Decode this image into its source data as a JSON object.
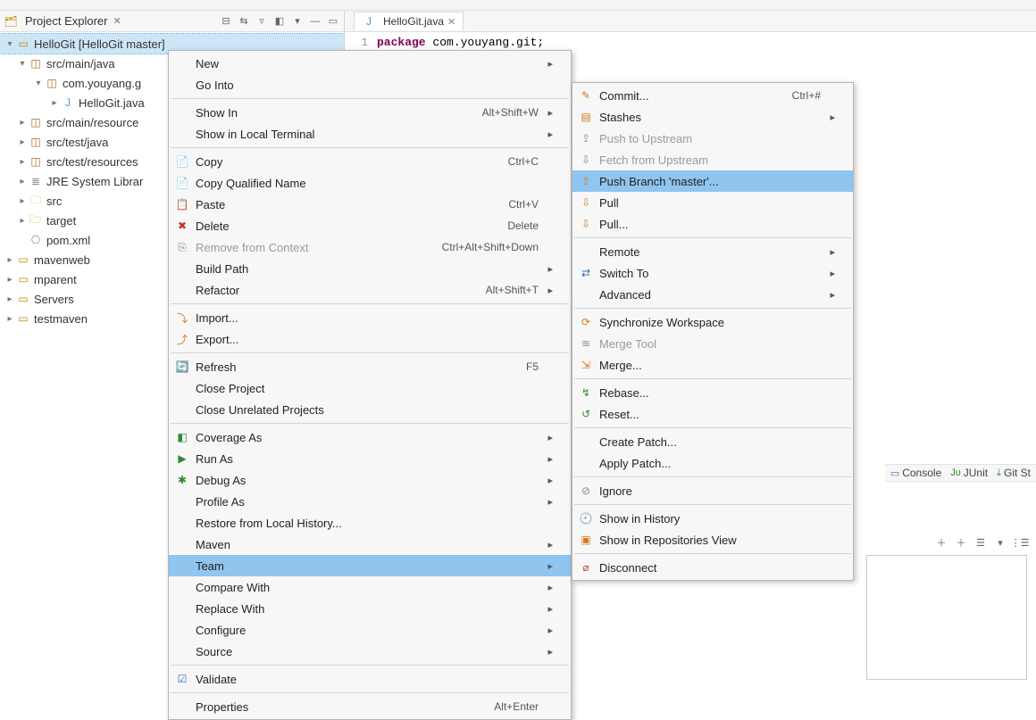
{
  "explorer": {
    "title": "Project Explorer",
    "tree": [
      {
        "id": "hellogit",
        "label": "HelloGit [HelloGit master]",
        "depth": 0,
        "icon": "project",
        "expanded": true,
        "selected": true
      },
      {
        "id": "src-main-java",
        "label": "src/main/java",
        "depth": 1,
        "icon": "pkg",
        "expanded": true
      },
      {
        "id": "com-youyang",
        "label": "com.youyang.g",
        "depth": 2,
        "icon": "pkg",
        "expanded": true
      },
      {
        "id": "hellogit-java",
        "label": "HelloGit.java",
        "depth": 3,
        "icon": "javafile",
        "expanded": false,
        "leafArrow": true
      },
      {
        "id": "src-main-res",
        "label": "src/main/resource",
        "depth": 1,
        "icon": "pkg",
        "expanded": false,
        "leafArrow": true
      },
      {
        "id": "src-test-java",
        "label": "src/test/java",
        "depth": 1,
        "icon": "pkg",
        "expanded": false,
        "leafArrow": true
      },
      {
        "id": "src-test-res",
        "label": "src/test/resources",
        "depth": 1,
        "icon": "pkg",
        "expanded": false,
        "leafArrow": true
      },
      {
        "id": "jre",
        "label": "JRE System Librar",
        "depth": 1,
        "icon": "jar",
        "expanded": false,
        "leafArrow": true
      },
      {
        "id": "src-folder",
        "label": "src",
        "depth": 1,
        "icon": "folder",
        "expanded": false,
        "leafArrow": true
      },
      {
        "id": "target",
        "label": "target",
        "depth": 1,
        "icon": "folder-open",
        "expanded": false,
        "leafArrow": true
      },
      {
        "id": "pom",
        "label": "pom.xml",
        "depth": 1,
        "icon": "xml",
        "expanded": false
      },
      {
        "id": "mavenweb",
        "label": "mavenweb",
        "depth": 0,
        "icon": "project",
        "expanded": false,
        "leafArrow": true
      },
      {
        "id": "mparent",
        "label": "mparent",
        "depth": 0,
        "icon": "project",
        "expanded": false,
        "leafArrow": true
      },
      {
        "id": "servers",
        "label": "Servers",
        "depth": 0,
        "icon": "project",
        "expanded": false,
        "leafArrow": true
      },
      {
        "id": "testmaven",
        "label": "testmaven",
        "depth": 0,
        "icon": "project",
        "expanded": false,
        "leafArrow": true
      }
    ]
  },
  "editor": {
    "tab": "HelloGit.java",
    "lineno": "1",
    "kw": "package",
    "rest": " com.youyang.git;"
  },
  "contextMenu": [
    {
      "label": "New",
      "submenu": true
    },
    {
      "label": "Go Into"
    },
    {
      "sep": true
    },
    {
      "label": "Show In",
      "accel": "Alt+Shift+W",
      "submenu": true
    },
    {
      "label": "Show in Local Terminal",
      "submenu": true
    },
    {
      "sep": true
    },
    {
      "label": "Copy",
      "icon": "copy",
      "accel": "Ctrl+C"
    },
    {
      "label": "Copy Qualified Name",
      "icon": "copy"
    },
    {
      "label": "Paste",
      "icon": "paste",
      "accel": "Ctrl+V"
    },
    {
      "label": "Delete",
      "icon": "delete",
      "accel": "Delete"
    },
    {
      "label": "Remove from Context",
      "icon": "remove",
      "accel": "Ctrl+Alt+Shift+Down",
      "disabled": true
    },
    {
      "label": "Build Path",
      "submenu": true
    },
    {
      "label": "Refactor",
      "accel": "Alt+Shift+T",
      "submenu": true
    },
    {
      "sep": true
    },
    {
      "label": "Import...",
      "icon": "import"
    },
    {
      "label": "Export...",
      "icon": "export"
    },
    {
      "sep": true
    },
    {
      "label": "Refresh",
      "icon": "refresh",
      "accel": "F5"
    },
    {
      "label": "Close Project"
    },
    {
      "label": "Close Unrelated Projects"
    },
    {
      "sep": true
    },
    {
      "label": "Coverage As",
      "icon": "coverage",
      "submenu": true
    },
    {
      "label": "Run As",
      "icon": "run",
      "submenu": true
    },
    {
      "label": "Debug As",
      "icon": "debug",
      "submenu": true
    },
    {
      "label": "Profile As",
      "submenu": true
    },
    {
      "label": "Restore from Local History..."
    },
    {
      "label": "Maven",
      "submenu": true
    },
    {
      "label": "Team",
      "submenu": true,
      "highlight": true
    },
    {
      "label": "Compare With",
      "submenu": true
    },
    {
      "label": "Replace With",
      "submenu": true
    },
    {
      "label": "Configure",
      "submenu": true
    },
    {
      "label": "Source",
      "submenu": true
    },
    {
      "sep": true
    },
    {
      "label": "Validate",
      "icon": "check"
    },
    {
      "sep": true
    },
    {
      "label": "Properties",
      "accel": "Alt+Enter"
    }
  ],
  "teamMenu": [
    {
      "label": "Commit...",
      "icon": "commit",
      "accel": "Ctrl+#"
    },
    {
      "label": "Stashes",
      "icon": "stash",
      "submenu": true
    },
    {
      "label": "Push to Upstream",
      "icon": "push-up",
      "disabled": true
    },
    {
      "label": "Fetch from Upstream",
      "icon": "fetch",
      "disabled": true
    },
    {
      "label": "Push Branch 'master'...",
      "icon": "push",
      "highlight": true
    },
    {
      "label": "Pull",
      "icon": "pull"
    },
    {
      "label": "Pull...",
      "icon": "pull"
    },
    {
      "sep": true
    },
    {
      "label": "Remote",
      "submenu": true
    },
    {
      "label": "Switch To",
      "icon": "switch",
      "submenu": true
    },
    {
      "label": "Advanced",
      "submenu": true
    },
    {
      "sep": true
    },
    {
      "label": "Synchronize Workspace",
      "icon": "sync"
    },
    {
      "label": "Merge Tool",
      "icon": "merge-tool",
      "disabled": true
    },
    {
      "label": "Merge...",
      "icon": "merge"
    },
    {
      "sep": true
    },
    {
      "label": "Rebase...",
      "icon": "rebase"
    },
    {
      "label": "Reset...",
      "icon": "reset"
    },
    {
      "sep": true
    },
    {
      "label": "Create Patch..."
    },
    {
      "label": "Apply Patch..."
    },
    {
      "sep": true
    },
    {
      "label": "Ignore",
      "icon": "ignore"
    },
    {
      "sep": true
    },
    {
      "label": "Show in History",
      "icon": "history"
    },
    {
      "label": "Show in Repositories View",
      "icon": "repo"
    },
    {
      "sep": true
    },
    {
      "label": "Disconnect",
      "icon": "disconnect"
    }
  ],
  "bottomViews": {
    "console": "Console",
    "junit": "JUnit",
    "gitStaging": "Git St"
  },
  "iconGlyphs": {
    "copy": "📄",
    "paste": "📋",
    "delete": "✖",
    "remove": "⎘",
    "import": "⤵",
    "export": "⤴",
    "refresh": "🔄",
    "coverage": "◧",
    "run": "▶",
    "debug": "✱",
    "check": "☑",
    "commit": "✎",
    "stash": "▤",
    "push-up": "⇪",
    "fetch": "⇩",
    "push": "⇧",
    "pull": "⇩",
    "switch": "⇄",
    "sync": "⟳",
    "merge-tool": "≋",
    "merge": "⇲",
    "rebase": "↯",
    "reset": "↺",
    "ignore": "⊘",
    "history": "🕘",
    "repo": "▣",
    "disconnect": "⌀",
    "project": "▭",
    "pkg": "◫",
    "folder": "🗀",
    "folder-open": "🗁",
    "javafile": "J",
    "jar": "≣",
    "xml": "⎔"
  }
}
